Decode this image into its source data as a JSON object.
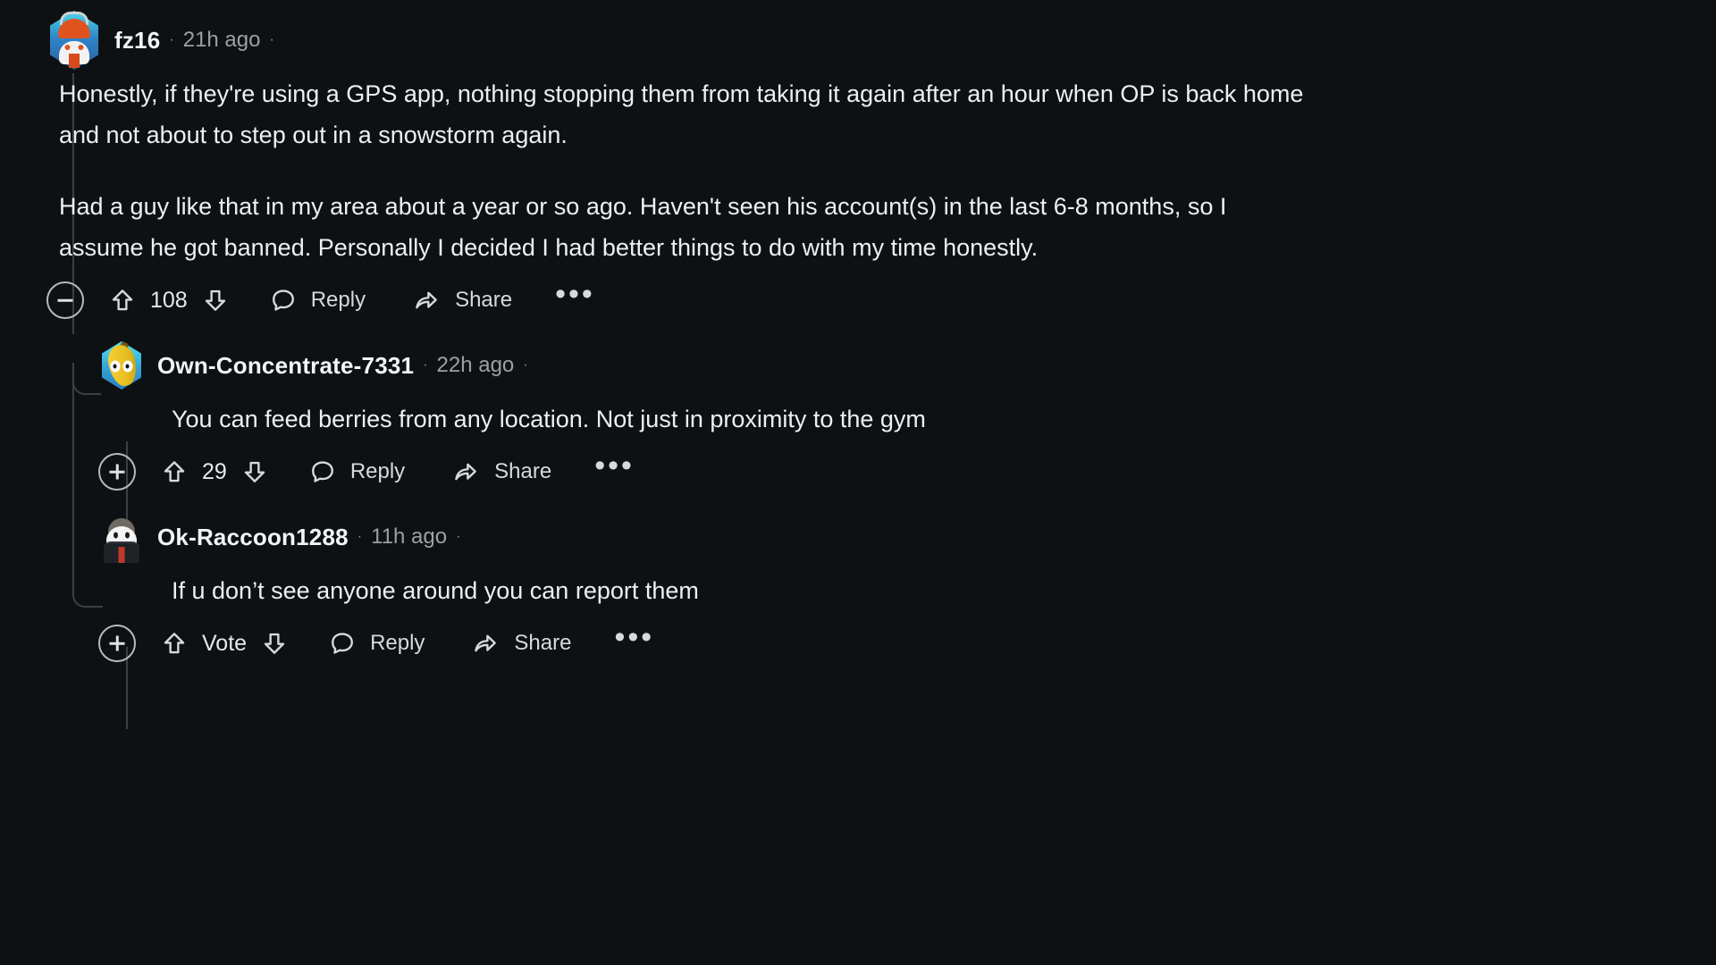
{
  "theme": {
    "background": "#0e1113",
    "text_primary": "#edeff1",
    "text_muted": "#9aa0a4",
    "thread_line": "#3a4044"
  },
  "comments": [
    {
      "id": "comment-1",
      "author": "fz16",
      "separator": "·",
      "timestamp": "21h ago",
      "avatar_icon": "snoo-avatar-icon",
      "paragraphs": [
        "Honestly, if they're using a GPS app, nothing stopping them from taking it again after an hour when OP is back home and not about to step out in a snowstorm again.",
        "Had a guy like that in my area about a year or so ago. Haven't seen his account(s) in the last 6-8 months, so I assume he got banned. Personally I decided I had better things to do with my time honestly."
      ],
      "actions": {
        "collapse_icon": "minus-circle-icon",
        "collapse_state": "expanded",
        "upvote_icon": "upvote-arrow-icon",
        "score": "108",
        "downvote_icon": "downvote-arrow-icon",
        "reply_icon": "comment-bubble-icon",
        "reply_label": "Reply",
        "share_icon": "share-arrow-icon",
        "share_label": "Share",
        "more_label": "•••",
        "more_icon": "overflow-menu-icon"
      }
    },
    {
      "id": "comment-2",
      "author": "Own-Concentrate-7331",
      "separator": "·",
      "timestamp": "22h ago",
      "avatar_icon": "banana-avatar-icon",
      "paragraphs": [
        "You can feed berries from any location. Not just in proximity to the gym"
      ],
      "actions": {
        "collapse_icon": "plus-circle-icon",
        "collapse_state": "collapsed",
        "upvote_icon": "upvote-arrow-icon",
        "score": "29",
        "downvote_icon": "downvote-arrow-icon",
        "reply_icon": "comment-bubble-icon",
        "reply_label": "Reply",
        "share_icon": "share-arrow-icon",
        "share_label": "Share",
        "more_label": "•••",
        "more_icon": "overflow-menu-icon"
      }
    },
    {
      "id": "comment-3",
      "author": "Ok-Raccoon1288",
      "separator": "·",
      "timestamp": "11h ago",
      "avatar_icon": "person-avatar-icon",
      "paragraphs": [
        "If u don’t see anyone around you can report them"
      ],
      "actions": {
        "collapse_icon": "plus-circle-icon",
        "collapse_state": "collapsed",
        "upvote_icon": "upvote-arrow-icon",
        "score": "Vote",
        "downvote_icon": "downvote-arrow-icon",
        "reply_icon": "comment-bubble-icon",
        "reply_label": "Reply",
        "share_icon": "share-arrow-icon",
        "share_label": "Share",
        "more_label": "•••",
        "more_icon": "overflow-menu-icon"
      }
    }
  ]
}
